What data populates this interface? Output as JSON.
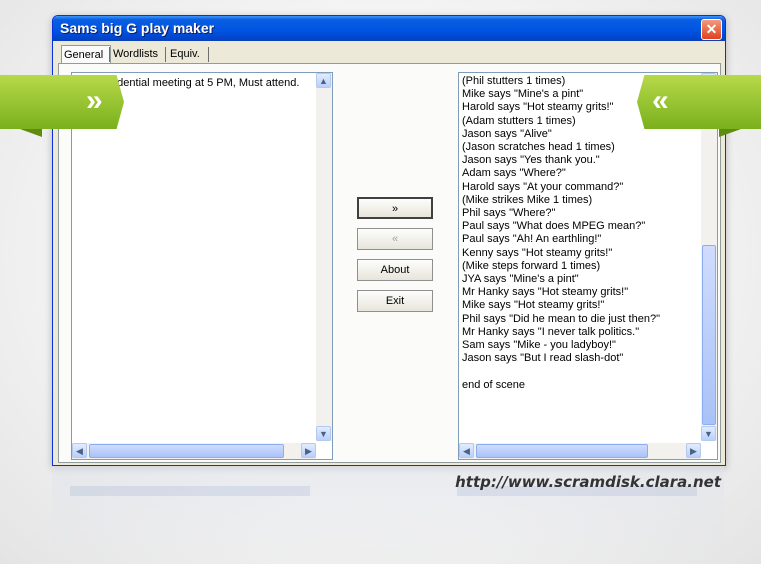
{
  "window": {
    "title": "Sams big G play maker",
    "close_label": "✕"
  },
  "tabs": [
    {
      "label": "General",
      "active": true
    },
    {
      "label": "Wordlists",
      "active": false
    },
    {
      "label": "Equiv.",
      "active": false
    }
  ],
  "input_panel": {
    "text": "Hi, Confidential meeting at 5 PM, Must attend."
  },
  "buttons": {
    "forward": "»",
    "back": "«",
    "about": "About",
    "exit": "Exit"
  },
  "output_panel": {
    "lines": [
      "(Phil stutters 1 times)",
      "Mike says \"Mine's a pint\"",
      "Harold says \"Hot steamy grits!\"",
      "(Adam stutters 1 times)",
      "Jason says \"Alive\"",
      "(Jason scratches head 1 times)",
      "Jason says \"Yes thank you.\"",
      "Adam says \"Where?\"",
      "Harold says \"At your command?\"",
      "(Mike strikes Mike 1 times)",
      "Phil says \"Where?\"",
      "Paul says \"What does MPEG mean?\"",
      "Paul says \"Ah! An earthling!\"",
      "Kenny says \"Hot steamy grits!\"",
      "(Mike steps forward 1 times)",
      "JYA says \"Mine's a pint\"",
      "Mr Hanky says \"Hot steamy grits!\"",
      "Mike says \"Hot steamy grits!\"",
      "Phil says \"Did he mean to die just then?\"",
      "Mr Hanky says \"I never talk politics.\"",
      "Sam says \"Mike - you ladyboy!\"",
      "Jason says \"But I read slash-dot\"",
      "",
      "end of scene"
    ]
  },
  "markers": {
    "left_glyph": "»",
    "right_glyph": "«"
  },
  "footer": {
    "url": "http://www.scramdisk.clara.net"
  },
  "colors": {
    "titlebar": "#0055e5",
    "marker_green": "#8cc02a",
    "window_bg": "#ece9d8"
  }
}
